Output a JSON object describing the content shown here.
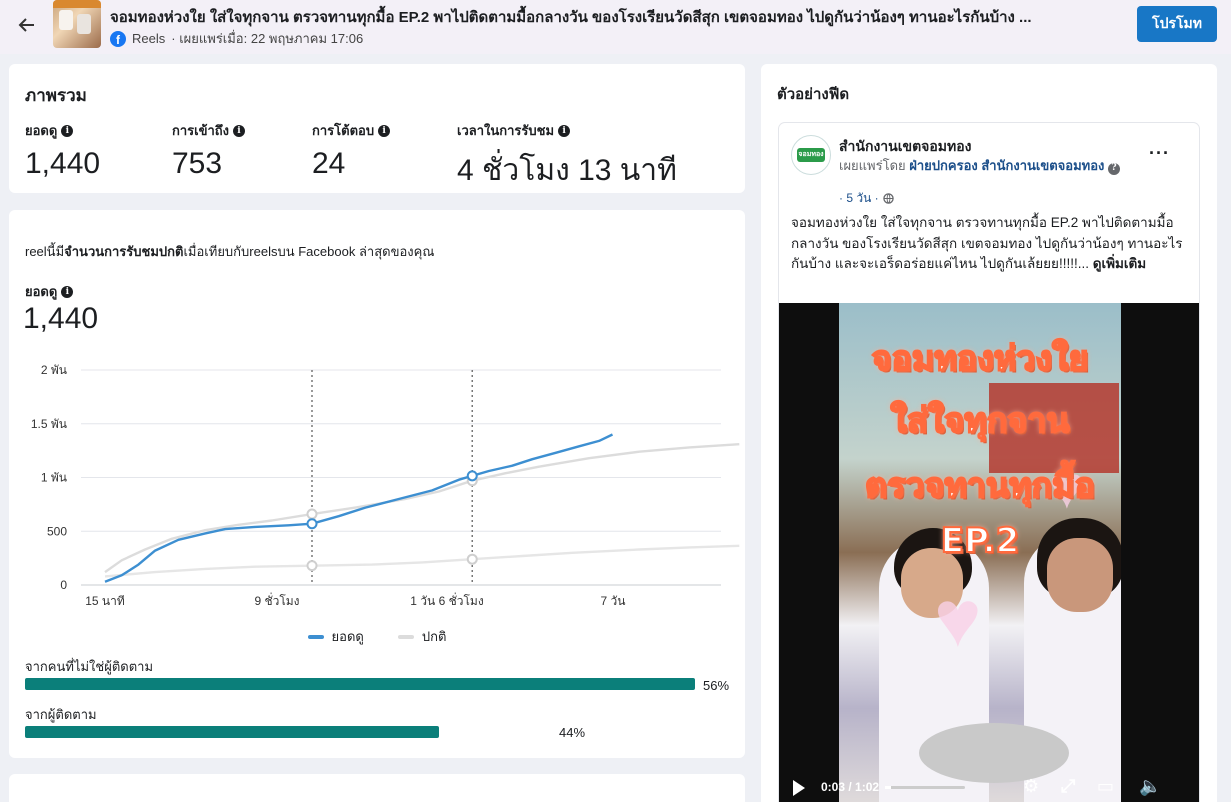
{
  "header": {
    "title": "จอมทองห่วงใย ใส่ใจทุกจาน ตรวจทานทุกมื้อ EP.2 พาไปติดตามมื้อกลางวัน ของโรงเรียนวัดสีสุก เขตจอมทอง ไปดูกันว่าน้องๆ ทานอะไรกันบ้าง ...",
    "type": "Reels",
    "published": "· เผยแพร่เมื่อ: 22 พฤษภาคม 17:06",
    "promote_label": "โปรโมท"
  },
  "overview": {
    "heading": "ภาพรวม",
    "metrics": [
      {
        "label": "ยอดดู",
        "value": "1,440"
      },
      {
        "label": "การเข้าถึง",
        "value": "753"
      },
      {
        "label": "การโต้ตอบ",
        "value": "24"
      },
      {
        "label": "เวลาในการรับชม",
        "value": "4 ชั่วโมง 13 นาที"
      }
    ]
  },
  "performance": {
    "desc_prefix": "reelนี้มี",
    "desc_bold": "จำนวนการรับชมปกติ",
    "desc_suffix": "เมื่อเทียบกับreelsบน Facebook ล่าสุดของคุณ",
    "views_label": "ยอดดู",
    "views_value": "1,440"
  },
  "chart_data": {
    "type": "line",
    "x_ticks": [
      "15 นาที",
      "9 ชั่วโมง",
      "1 วัน 6 ชั่วโมง",
      "7 วัน"
    ],
    "y_ticks": [
      "0",
      "500",
      "1 พัน",
      "1.5 พัน",
      "2 พัน"
    ],
    "ylim": [
      0,
      2000
    ],
    "legend_position": "bottom",
    "series": [
      {
        "name": "ยอดดู",
        "color": "#3d8fd1",
        "points": [
          [
            0,
            30
          ],
          [
            0.05,
            90
          ],
          [
            0.1,
            190
          ],
          [
            0.15,
            320
          ],
          [
            0.22,
            420
          ],
          [
            0.3,
            480
          ],
          [
            0.36,
            520
          ],
          [
            0.45,
            540
          ],
          [
            0.55,
            555
          ],
          [
            0.62,
            570
          ],
          [
            0.7,
            640
          ],
          [
            0.78,
            720
          ],
          [
            0.88,
            800
          ],
          [
            0.98,
            880
          ],
          [
            1.06,
            980
          ],
          [
            1.15,
            1060
          ],
          [
            1.22,
            1110
          ],
          [
            1.28,
            1170
          ],
          [
            1.35,
            1230
          ],
          [
            1.42,
            1290
          ],
          [
            1.48,
            1340
          ],
          [
            1.52,
            1400
          ]
        ]
      },
      {
        "name": "ปกติ",
        "color": "#dcdcdc",
        "points": [
          [
            0,
            120
          ],
          [
            0.05,
            230
          ],
          [
            0.12,
            330
          ],
          [
            0.2,
            430
          ],
          [
            0.3,
            510
          ],
          [
            0.4,
            560
          ],
          [
            0.5,
            600
          ],
          [
            0.62,
            660
          ],
          [
            0.75,
            720
          ],
          [
            0.9,
            800
          ],
          [
            1.0,
            870
          ],
          [
            1.1,
            970
          ],
          [
            1.2,
            1040
          ],
          [
            1.3,
            1100
          ],
          [
            1.45,
            1180
          ],
          [
            1.6,
            1240
          ],
          [
            1.75,
            1280
          ],
          [
            1.9,
            1310
          ]
        ]
      },
      {
        "name": "",
        "color": "#e6e6e6",
        "points": [
          [
            0,
            80
          ],
          [
            0.15,
            120
          ],
          [
            0.3,
            150
          ],
          [
            0.45,
            170
          ],
          [
            0.62,
            180
          ],
          [
            0.8,
            190
          ],
          [
            0.95,
            210
          ],
          [
            1.1,
            240
          ],
          [
            1.25,
            270
          ],
          [
            1.4,
            300
          ],
          [
            1.6,
            330
          ],
          [
            1.75,
            350
          ],
          [
            1.9,
            365
          ]
        ]
      }
    ],
    "markers_x": [
      0.62,
      1.1
    ]
  },
  "distribution": [
    {
      "label": "จากคนที่ไม่ใช่ผู้ติดตาม",
      "percent": 56,
      "pct_text": "56%"
    },
    {
      "label": "จากผู้ติดตาม",
      "percent": 44,
      "pct_text": "44%"
    }
  ],
  "feed": {
    "heading": "ตัวอย่างฟีด",
    "page_name": "สำนักงานเขตจอมทอง",
    "logo_text": "จอมทอง",
    "pub_prefix": "เผยแพร่โดย ",
    "pub_by": "ฝ่ายปกครอง สำนักงานเขตจอมทอง",
    "date": "· 5 วัน ·",
    "text": "จอมทองห่วงใย ใส่ใจทุกจาน ตรวจทานทุกมื้อ EP.2 พาไปติดตามมื้อกลางวัน ของโรงเรียนวัดสีสุก เขตจอมทอง ไปดูกันว่าน้องๆ ทานอะไรกันบ้าง และจะเอร็ดอร่อยแค่ไหน ไปดูกันเล้ยยย!!!!!... ",
    "see_more": "ดูเพิ่มเติม",
    "overlay": [
      "จอมทองห่วงใย",
      "ใส่ใจทุกจาน",
      "ตรวจทานทุกมื้อ",
      "EP.2"
    ],
    "video_time": "0:03 / 1:02"
  }
}
